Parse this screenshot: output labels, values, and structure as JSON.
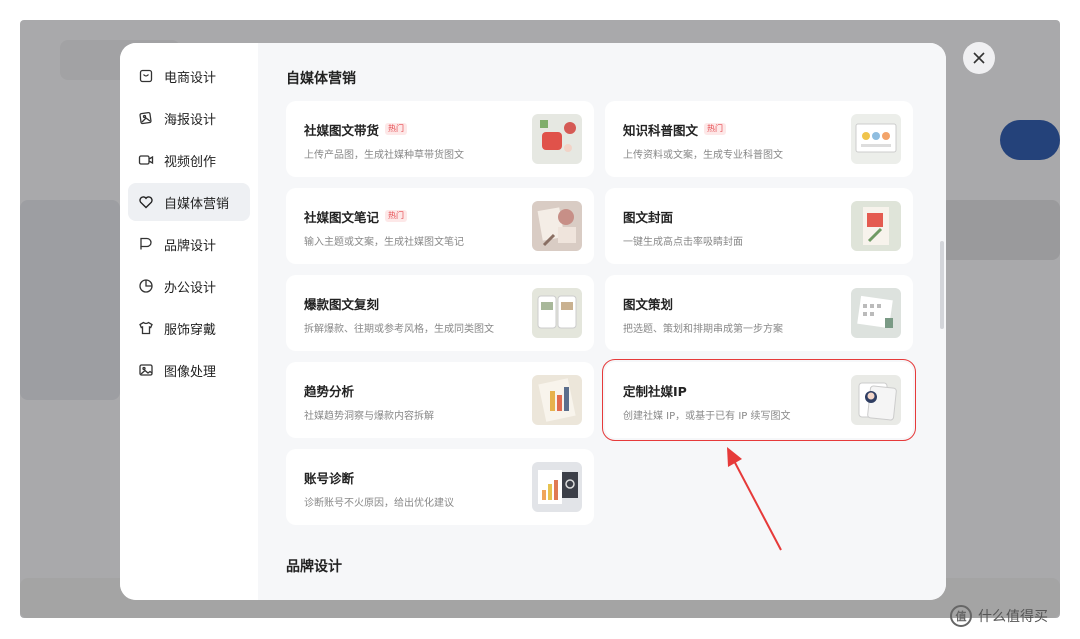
{
  "sidebar": {
    "items": [
      {
        "label": "电商设计",
        "icon": "shopping-bag-icon"
      },
      {
        "label": "海报设计",
        "icon": "poster-icon"
      },
      {
        "label": "视频创作",
        "icon": "video-camera-icon"
      },
      {
        "label": "自媒体营销",
        "icon": "heart-icon",
        "active": true
      },
      {
        "label": "品牌设计",
        "icon": "brand-icon"
      },
      {
        "label": "办公设计",
        "icon": "pie-chart-icon"
      },
      {
        "label": "服饰穿戴",
        "icon": "shirt-icon"
      },
      {
        "label": "图像处理",
        "icon": "image-icon"
      }
    ]
  },
  "sections": [
    {
      "title": "自媒体营销"
    },
    {
      "title": "品牌设计"
    }
  ],
  "cards": [
    {
      "title": "社媒图文带货",
      "tag": "热门",
      "desc": "上传产品图，生成社媒种草带货图文"
    },
    {
      "title": "知识科普图文",
      "tag": "热门",
      "desc": "上传资料或文案，生成专业科普图文"
    },
    {
      "title": "社媒图文笔记",
      "tag": "热门",
      "desc": "输入主题或文案，生成社媒图文笔记"
    },
    {
      "title": "图文封面",
      "tag": "",
      "desc": "一键生成高点击率吸睛封面"
    },
    {
      "title": "爆款图文复刻",
      "tag": "",
      "desc": "拆解爆款、往期或参考风格，生成同类图文"
    },
    {
      "title": "图文策划",
      "tag": "",
      "desc": "把选题、策划和排期串成第一步方案"
    },
    {
      "title": "趋势分析",
      "tag": "",
      "desc": "社媒趋势洞察与爆款内容拆解"
    },
    {
      "title": "定制社媒IP",
      "tag": "",
      "desc": "创建社媒 IP，或基于已有 IP 续写图文",
      "highlighted": true
    },
    {
      "title": "账号诊断",
      "tag": "",
      "desc": "诊断账号不火原因，给出优化建议"
    }
  ],
  "watermark": {
    "text": "什么值得买",
    "icon_text": "值"
  },
  "colors": {
    "highlight": "#e63a3a",
    "hot_tag": "#e5484d",
    "active_bg": "#eef0f3"
  }
}
